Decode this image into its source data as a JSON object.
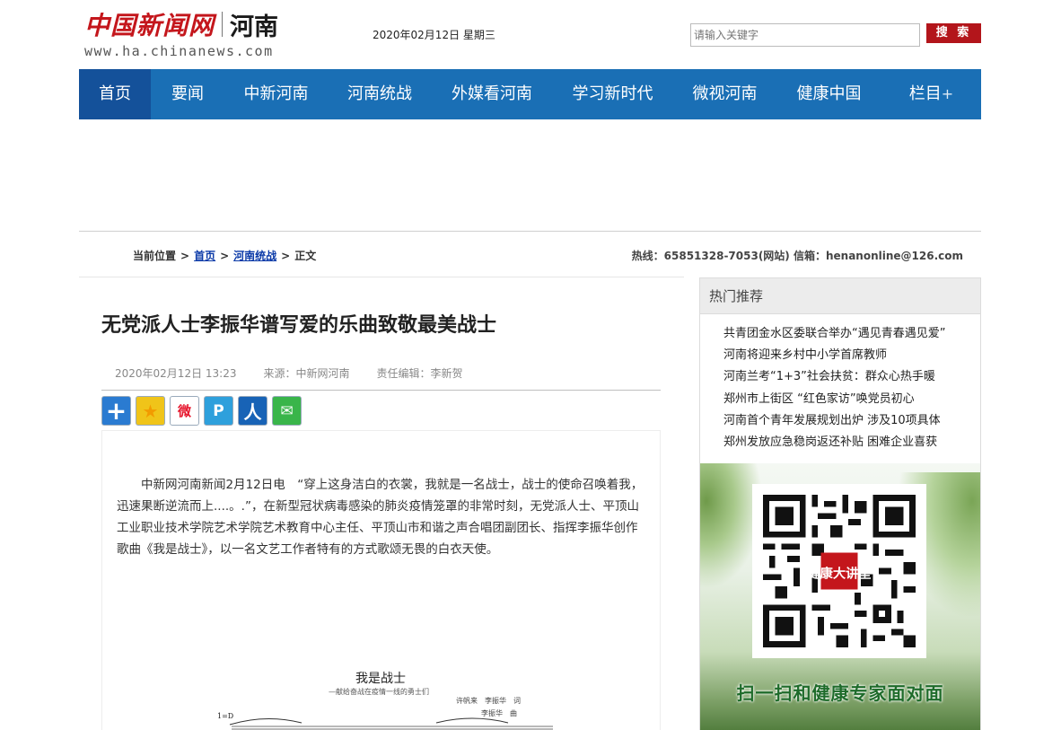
{
  "header": {
    "logo_cn": "中国新闻网",
    "logo_region": "河南",
    "logo_domain": "www.ha.chinanews.com",
    "date": "2020年02月12日 星期三",
    "search_placeholder": "请输入关键字",
    "search_button": "搜 索"
  },
  "nav": {
    "items": [
      {
        "label": "首页",
        "width": 80
      },
      {
        "label": "要闻",
        "width": 82
      },
      {
        "label": "中新河南",
        "width": 115
      },
      {
        "label": "河南统战",
        "width": 116
      },
      {
        "label": "外媒看河南",
        "width": 134
      },
      {
        "label": "学习新时代",
        "width": 135
      },
      {
        "label": "微视河南",
        "width": 115
      },
      {
        "label": "健康中国",
        "width": 117
      },
      {
        "label": "栏目",
        "width": 111
      }
    ],
    "more_symbol": "+"
  },
  "breadcrumb": {
    "prefix": "当前位置",
    "home": "首页",
    "section": "河南统战",
    "current": "正文",
    "separator": ">"
  },
  "contact": "热线：65851328-7053(网站) 信箱：henanonline@126.com",
  "article": {
    "title": "无党派人士李振华谱写爱的乐曲致敬最美战士",
    "time": "2020年02月12日 13:23",
    "source": "来源：中新网河南",
    "editor": "责任编辑：李新贺",
    "paragraph": "中新网河南新闻2月12日电　“穿上这身洁白的衣裳，我就是一名战士，战士的使命召唤着我，迅速果断逆流而上....。.”，在新型冠状病毒感染的肺炎疫情笼罩的非常时刻，无党派人士、平顶山工业职业技术学院艺术学院艺术教育中心主任、平顶山市和谐之声合唱团副团长、指挥李振华创作歌曲《我是战士》，以一名文艺工作者特有的方式歌颂无畏的白衣天使。",
    "score": {
      "title": "我是战士",
      "subtitle": "—献给奋战在疫情一线的勇士们",
      "credit_lyrics": "许帆来　李振华　词",
      "credit_music": "李振华　曲",
      "key": "1=D"
    }
  },
  "share": [
    {
      "name": "share-more-icon",
      "color": "#2a7bd1",
      "glyph": "+"
    },
    {
      "name": "qzone-icon",
      "color": "#f0c419",
      "glyph": "★"
    },
    {
      "name": "weibo-icon",
      "color": "#ffffff",
      "glyph": "微"
    },
    {
      "name": "tencent-weibo-icon",
      "color": "#2ea0dc",
      "glyph": "P"
    },
    {
      "name": "renren-icon",
      "color": "#1863b6",
      "glyph": "人"
    },
    {
      "name": "wechat-icon",
      "color": "#39b54a",
      "glyph": "✉"
    }
  ],
  "sidebar": {
    "heading": "热门推荐",
    "items": [
      "共青团金水区委联合举办“遇见青春遇见爱”",
      "河南将迎来乡村中小学首席教师",
      "河南兰考“1+3”社会扶贫：群众心热手暖",
      "郑州市上街区 “红色家访”唤党员初心",
      "河南首个青年发展规划出炉 涉及10项具体",
      "郑州发放应急稳岗返还补贴 困难企业喜获"
    ],
    "ad_text": "扫一扫和健康专家面对面",
    "ad_qr_center": "健康大讲堂"
  }
}
